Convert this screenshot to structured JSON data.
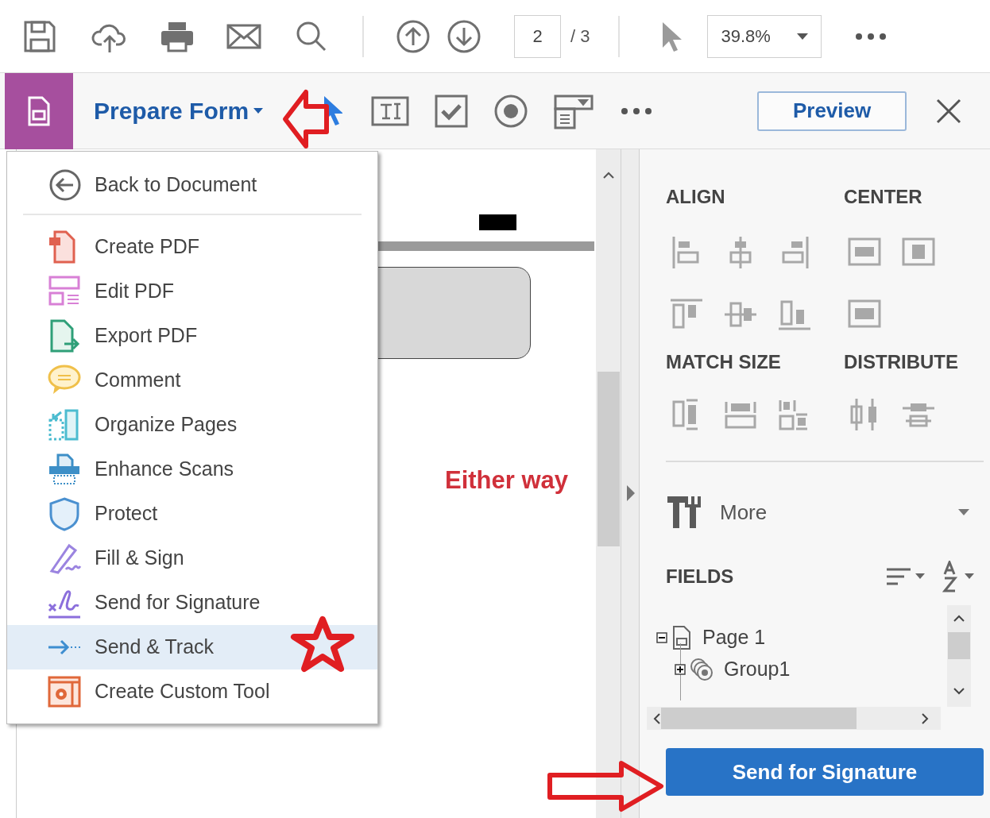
{
  "top_toolbar": {
    "page_current": "2",
    "page_total": "/ 3",
    "zoom": "39.8%"
  },
  "tool_bar": {
    "title": "Prepare Form",
    "preview": "Preview"
  },
  "menu": {
    "back": "Back to Document",
    "items": [
      {
        "label": "Create PDF",
        "selected": false
      },
      {
        "label": "Edit PDF",
        "selected": false
      },
      {
        "label": "Export PDF",
        "selected": false
      },
      {
        "label": "Comment",
        "selected": false
      },
      {
        "label": "Organize Pages",
        "selected": false
      },
      {
        "label": "Enhance Scans",
        "selected": false
      },
      {
        "label": "Protect",
        "selected": false
      },
      {
        "label": "Fill & Sign",
        "selected": false
      },
      {
        "label": "Send for Signature",
        "selected": false
      },
      {
        "label": "Send & Track",
        "selected": true
      },
      {
        "label": "Create Custom Tool",
        "selected": false
      }
    ]
  },
  "annotation": "Either way",
  "right_panel": {
    "align": "ALIGN",
    "center": "CENTER",
    "match_size": "MATCH SIZE",
    "distribute": "DISTRIBUTE",
    "more": "More",
    "fields": "FIELDS",
    "tree": [
      {
        "label": "Page 1",
        "expanded": true,
        "children": [
          {
            "label": "Group1",
            "expanded": false
          }
        ]
      }
    ],
    "send_button": "Send for Signature"
  }
}
